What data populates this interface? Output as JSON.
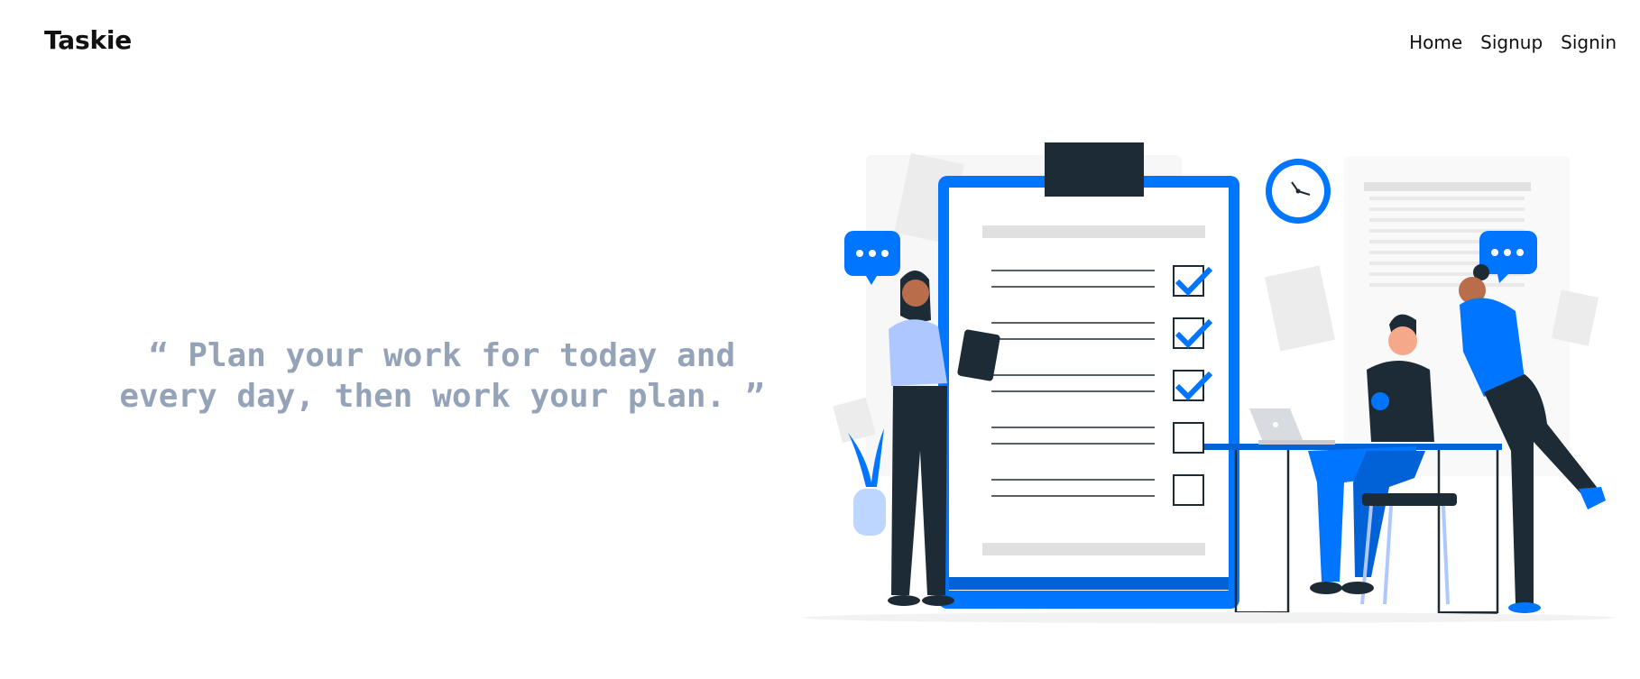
{
  "header": {
    "brand": "Taskie",
    "nav": [
      {
        "label": "Home"
      },
      {
        "label": "Signup"
      },
      {
        "label": "Signin"
      }
    ]
  },
  "hero": {
    "quote_open": "“",
    "quote_text_line1": "Plan your work for today and",
    "quote_text_line2": "every day, then work your plan.",
    "quote_close": "”"
  },
  "illustration": {
    "name": "task-checklist-illustration",
    "accent": "#0075ff",
    "dark": "#1d2b36",
    "checklist": [
      {
        "checked": true
      },
      {
        "checked": true
      },
      {
        "checked": true
      },
      {
        "checked": false
      },
      {
        "checked": false
      }
    ],
    "speech_bubble_text": "•••"
  }
}
